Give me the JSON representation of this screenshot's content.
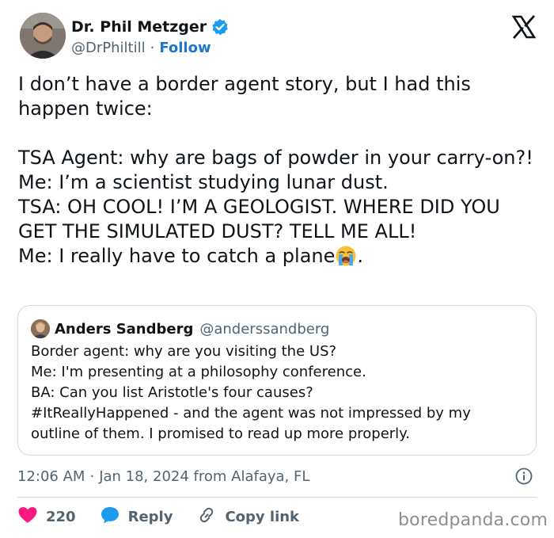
{
  "author": {
    "name": "Dr. Phil Metzger",
    "handle": "@DrPhiltill",
    "separator": "·",
    "follow_label": "Follow",
    "verified": true
  },
  "tweet": {
    "lines": [
      "I don’t have a border agent story, but I had this happen twice:",
      "",
      "TSA Agent: why are bags of powder in your carry-on?!",
      "Me: I’m a scientist studying lunar dust.",
      "TSA: OH COOL! I’M A GEOLOGIST. WHERE DID YOU GET THE SIMULATED DUST? TELL ME ALL!"
    ],
    "last_line_text": "Me: I really have to catch a plane",
    "last_line_suffix": ".",
    "emoji": "loudly-crying-face"
  },
  "quote": {
    "author_name": "Anders Sandberg",
    "author_handle": "@anderssandberg",
    "lines": [
      "Border agent: why are you visiting the US?",
      "Me: I'm presenting at a philosophy conference.",
      "BA: Can you list Aristotle's four causes?",
      "#ItReallyHappened - and the agent was not impressed by my",
      "outline of them. I promised to read up more properly."
    ]
  },
  "meta": {
    "time": "12:06 AM",
    "separator": "·",
    "date_location": "Jan 18, 2024 from Alafaya, FL"
  },
  "actions": {
    "like_count": "220",
    "reply_label": "Reply",
    "copy_label": "Copy link"
  },
  "watermark": "boredpanda.com",
  "colors": {
    "link_blue": "#1d76c9",
    "verified_blue": "#1d9bf0",
    "like_pink": "#f91880",
    "muted_text": "#536471",
    "border": "#cfd9de"
  },
  "icons": [
    "verified-badge-icon",
    "x-logo-icon",
    "info-icon",
    "heart-icon",
    "reply-bubble-icon",
    "link-icon",
    "loudly-crying-face-emoji"
  ]
}
